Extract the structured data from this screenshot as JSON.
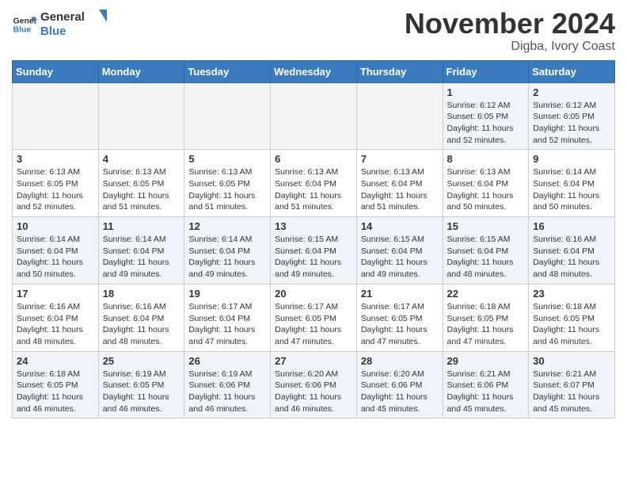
{
  "header": {
    "logo_line1": "General",
    "logo_line2": "Blue",
    "month_title": "November 2024",
    "location": "Digba, Ivory Coast"
  },
  "days_of_week": [
    "Sunday",
    "Monday",
    "Tuesday",
    "Wednesday",
    "Thursday",
    "Friday",
    "Saturday"
  ],
  "weeks": [
    [
      {
        "day": "",
        "info": "",
        "empty": true
      },
      {
        "day": "",
        "info": "",
        "empty": true
      },
      {
        "day": "",
        "info": "",
        "empty": true
      },
      {
        "day": "",
        "info": "",
        "empty": true
      },
      {
        "day": "",
        "info": "",
        "empty": true
      },
      {
        "day": "1",
        "info": "Sunrise: 6:12 AM\nSunset: 6:05 PM\nDaylight: 11 hours\nand 52 minutes."
      },
      {
        "day": "2",
        "info": "Sunrise: 6:12 AM\nSunset: 6:05 PM\nDaylight: 11 hours\nand 52 minutes."
      }
    ],
    [
      {
        "day": "3",
        "info": "Sunrise: 6:13 AM\nSunset: 6:05 PM\nDaylight: 11 hours\nand 52 minutes."
      },
      {
        "day": "4",
        "info": "Sunrise: 6:13 AM\nSunset: 6:05 PM\nDaylight: 11 hours\nand 51 minutes."
      },
      {
        "day": "5",
        "info": "Sunrise: 6:13 AM\nSunset: 6:05 PM\nDaylight: 11 hours\nand 51 minutes."
      },
      {
        "day": "6",
        "info": "Sunrise: 6:13 AM\nSunset: 6:04 PM\nDaylight: 11 hours\nand 51 minutes."
      },
      {
        "day": "7",
        "info": "Sunrise: 6:13 AM\nSunset: 6:04 PM\nDaylight: 11 hours\nand 51 minutes."
      },
      {
        "day": "8",
        "info": "Sunrise: 6:13 AM\nSunset: 6:04 PM\nDaylight: 11 hours\nand 50 minutes."
      },
      {
        "day": "9",
        "info": "Sunrise: 6:14 AM\nSunset: 6:04 PM\nDaylight: 11 hours\nand 50 minutes."
      }
    ],
    [
      {
        "day": "10",
        "info": "Sunrise: 6:14 AM\nSunset: 6:04 PM\nDaylight: 11 hours\nand 50 minutes."
      },
      {
        "day": "11",
        "info": "Sunrise: 6:14 AM\nSunset: 6:04 PM\nDaylight: 11 hours\nand 49 minutes."
      },
      {
        "day": "12",
        "info": "Sunrise: 6:14 AM\nSunset: 6:04 PM\nDaylight: 11 hours\nand 49 minutes."
      },
      {
        "day": "13",
        "info": "Sunrise: 6:15 AM\nSunset: 6:04 PM\nDaylight: 11 hours\nand 49 minutes."
      },
      {
        "day": "14",
        "info": "Sunrise: 6:15 AM\nSunset: 6:04 PM\nDaylight: 11 hours\nand 49 minutes."
      },
      {
        "day": "15",
        "info": "Sunrise: 6:15 AM\nSunset: 6:04 PM\nDaylight: 11 hours\nand 48 minutes."
      },
      {
        "day": "16",
        "info": "Sunrise: 6:16 AM\nSunset: 6:04 PM\nDaylight: 11 hours\nand 48 minutes."
      }
    ],
    [
      {
        "day": "17",
        "info": "Sunrise: 6:16 AM\nSunset: 6:04 PM\nDaylight: 11 hours\nand 48 minutes."
      },
      {
        "day": "18",
        "info": "Sunrise: 6:16 AM\nSunset: 6:04 PM\nDaylight: 11 hours\nand 48 minutes."
      },
      {
        "day": "19",
        "info": "Sunrise: 6:17 AM\nSunset: 6:04 PM\nDaylight: 11 hours\nand 47 minutes."
      },
      {
        "day": "20",
        "info": "Sunrise: 6:17 AM\nSunset: 6:05 PM\nDaylight: 11 hours\nand 47 minutes."
      },
      {
        "day": "21",
        "info": "Sunrise: 6:17 AM\nSunset: 6:05 PM\nDaylight: 11 hours\nand 47 minutes."
      },
      {
        "day": "22",
        "info": "Sunrise: 6:18 AM\nSunset: 6:05 PM\nDaylight: 11 hours\nand 47 minutes."
      },
      {
        "day": "23",
        "info": "Sunrise: 6:18 AM\nSunset: 6:05 PM\nDaylight: 11 hours\nand 46 minutes."
      }
    ],
    [
      {
        "day": "24",
        "info": "Sunrise: 6:18 AM\nSunset: 6:05 PM\nDaylight: 11 hours\nand 46 minutes."
      },
      {
        "day": "25",
        "info": "Sunrise: 6:19 AM\nSunset: 6:05 PM\nDaylight: 11 hours\nand 46 minutes."
      },
      {
        "day": "26",
        "info": "Sunrise: 6:19 AM\nSunset: 6:06 PM\nDaylight: 11 hours\nand 46 minutes."
      },
      {
        "day": "27",
        "info": "Sunrise: 6:20 AM\nSunset: 6:06 PM\nDaylight: 11 hours\nand 46 minutes."
      },
      {
        "day": "28",
        "info": "Sunrise: 6:20 AM\nSunset: 6:06 PM\nDaylight: 11 hours\nand 45 minutes."
      },
      {
        "day": "29",
        "info": "Sunrise: 6:21 AM\nSunset: 6:06 PM\nDaylight: 11 hours\nand 45 minutes."
      },
      {
        "day": "30",
        "info": "Sunrise: 6:21 AM\nSunset: 6:07 PM\nDaylight: 11 hours\nand 45 minutes."
      }
    ]
  ]
}
